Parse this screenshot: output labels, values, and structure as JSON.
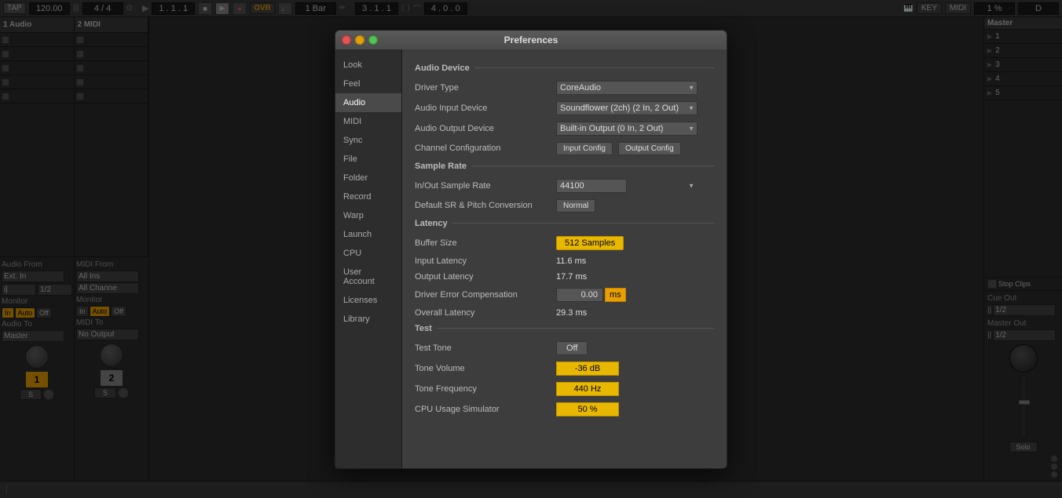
{
  "topbar": {
    "tap_label": "TAP",
    "bpm": "120.00",
    "time_sig": "4 / 4",
    "loop_btn": "⟳",
    "position": "1 . 1 . 1",
    "bar_setting": "1 Bar",
    "pos_right": "3 . 1 . 1",
    "beat_right": "4 . 0 . 0",
    "ovr_label": "OVR",
    "key_label": "KEY",
    "midi_label": "MIDI",
    "cpu_label": "1 %",
    "d_label": "D"
  },
  "tracks": {
    "track1_name": "1 Audio",
    "track2_name": "2 MIDI",
    "track1_num": "1",
    "track2_num": "2",
    "track1_solo": "S",
    "track2_solo": "S"
  },
  "master": {
    "title": "Master",
    "stop_clips_label": "Stop Clips",
    "rows": [
      "1",
      "2",
      "3",
      "4",
      "5"
    ],
    "cue_out_label": "Cue Out",
    "cue_out_val": "1/2",
    "master_out_label": "Master Out",
    "master_out_val": "1/2",
    "solo_label": "Solo"
  },
  "preferences": {
    "title": "Preferences",
    "nav_items": [
      {
        "id": "look",
        "label": "Look"
      },
      {
        "id": "feel",
        "label": "Feel"
      },
      {
        "id": "audio",
        "label": "Audio",
        "active": true
      },
      {
        "id": "midi",
        "label": "MIDI"
      },
      {
        "id": "sync",
        "label": "Sync"
      },
      {
        "id": "file",
        "label": "File"
      },
      {
        "id": "folder",
        "label": "Folder"
      },
      {
        "id": "record",
        "label": "Record"
      },
      {
        "id": "warp",
        "label": "Warp"
      },
      {
        "id": "launch",
        "label": "Launch"
      },
      {
        "id": "cpu",
        "label": "CPU"
      },
      {
        "id": "user_account",
        "label": "User Account"
      },
      {
        "id": "licenses",
        "label": "Licenses"
      },
      {
        "id": "library",
        "label": "Library"
      }
    ],
    "audio_device_section": "Audio Device",
    "driver_type_label": "Driver Type",
    "driver_type_value": "CoreAudio",
    "audio_input_label": "Audio Input Device",
    "audio_input_value": "Soundflower (2ch) (2 In, 2 Out)",
    "audio_output_label": "Audio Output Device",
    "audio_output_value": "Built-in Output (0 In, 2 Out)",
    "channel_config_label": "Channel Configuration",
    "input_config_btn": "Input Config",
    "output_config_btn": "Output Config",
    "sample_rate_section": "Sample Rate",
    "inout_rate_label": "In/Out Sample Rate",
    "inout_rate_value": "44100",
    "default_sr_label": "Default SR & Pitch Conversion",
    "default_sr_btn": "Normal",
    "latency_section": "Latency",
    "buffer_size_label": "Buffer Size",
    "buffer_size_value": "512 Samples",
    "input_latency_label": "Input Latency",
    "input_latency_value": "11.6 ms",
    "output_latency_label": "Output Latency",
    "output_latency_value": "17.7 ms",
    "driver_error_label": "Driver Error Compensation",
    "driver_error_value": "0.00",
    "driver_error_unit": "ms",
    "overall_latency_label": "Overall Latency",
    "overall_latency_value": "29.3 ms",
    "test_section": "Test",
    "test_tone_label": "Test Tone",
    "test_tone_value": "Off",
    "tone_volume_label": "Tone Volume",
    "tone_volume_value": "-36 dB",
    "tone_freq_label": "Tone Frequency",
    "tone_freq_value": "440 Hz",
    "cpu_sim_label": "CPU Usage Simulator",
    "cpu_sim_value": "50 %"
  }
}
